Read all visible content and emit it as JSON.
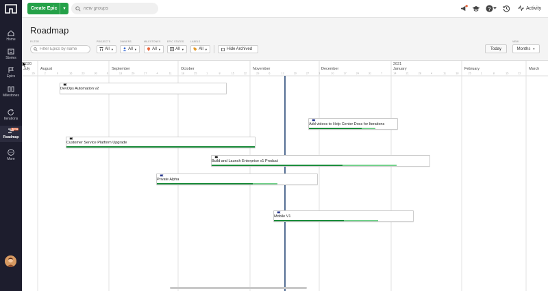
{
  "topbar": {
    "create_epic_label": "Create Epic",
    "search_placeholder": "new groups",
    "activity_label": "Activity"
  },
  "nav": {
    "items": [
      {
        "label": "Home",
        "icon": "home-icon"
      },
      {
        "label": "Stories",
        "icon": "stories-icon"
      },
      {
        "label": "Epics",
        "icon": "epics-icon"
      },
      {
        "label": "Milestones",
        "icon": "milestones-icon"
      },
      {
        "label": "Iterations",
        "icon": "iterations-icon"
      },
      {
        "label": "Roadmap",
        "icon": "roadmap-icon",
        "active": true,
        "badge": "BETA"
      },
      {
        "label": "More",
        "icon": "more-icon"
      }
    ]
  },
  "page": {
    "title": "Roadmap",
    "filter_label": "FILTER",
    "filter_placeholder": "Filter Epics by name",
    "projects_label": "PROJECTS",
    "projects_value": "All",
    "owners_label": "OWNERS",
    "owners_value": "All",
    "milestones_label": "MILESTONES",
    "milestones_value": "All",
    "epic_states_label": "EPIC STATES",
    "epic_states_value": "All",
    "labels_label": "LABELS",
    "labels_value": "All",
    "hide_archived_label": "Hide Archived",
    "today_label": "Today",
    "view_label": "VIEW",
    "view_value": "Months"
  },
  "timeline": {
    "year_start": "2020",
    "year_next": "2021",
    "months": [
      "July",
      "August",
      "September",
      "October",
      "November",
      "December",
      "January",
      "February",
      "March"
    ],
    "week_ticks": [
      "26",
      "2",
      "9",
      "16",
      "23",
      "30",
      "6",
      "13",
      "20",
      "27",
      "4",
      "11",
      "18",
      "25",
      "1",
      "8",
      "15",
      "22",
      "29",
      "6",
      "13",
      "20",
      "27",
      "3",
      "10",
      "17",
      "24",
      "31",
      "7",
      "14",
      "21",
      "28",
      "4",
      "11",
      "18",
      "25",
      "1",
      "8",
      "15",
      "22"
    ],
    "epics": [
      {
        "name": "DevOps Automation v2",
        "progress_done": 0,
        "progress_started": 0
      },
      {
        "name": "Add videos to Help Center Docs for Iterations",
        "progress_done": 0.6,
        "progress_started": 0.75
      },
      {
        "name": "Customer Service Platform Upgrade",
        "progress_done": 1.0,
        "progress_started": 1.0
      },
      {
        "name": "Build and Launch Enterprise v1 Product",
        "progress_done": 0.6,
        "progress_started": 0.85
      },
      {
        "name": "Private Alpha",
        "progress_done": 0.6,
        "progress_started": 0.75
      },
      {
        "name": "Mobile V1",
        "progress_done": 0.5,
        "progress_started": 0.75
      }
    ],
    "colors": {
      "progress_done": "#1a8d3b",
      "progress_started": "#73d18b",
      "today_line": "#2a4a7a"
    }
  }
}
